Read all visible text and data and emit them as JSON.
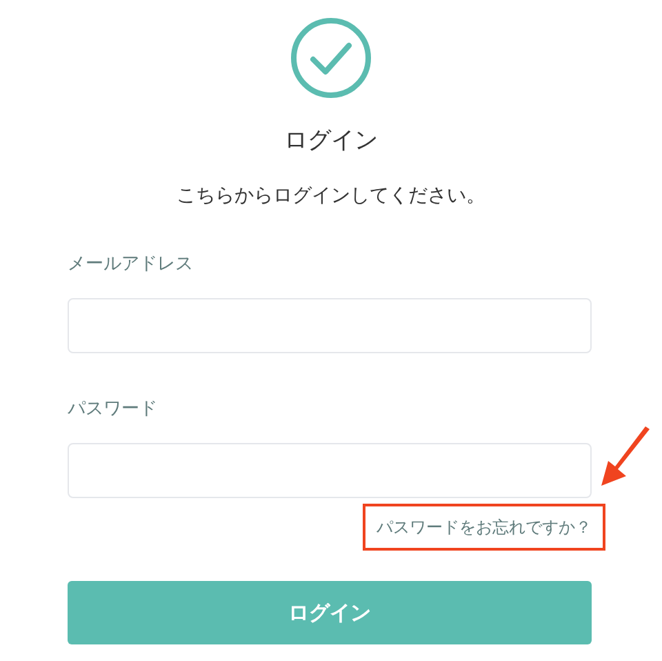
{
  "title": "ログイン",
  "subtitle": "こちらからログインしてください。",
  "fields": [
    {
      "label": "メールアドレス"
    },
    {
      "label": "パスワード"
    }
  ],
  "forgot_link": {
    "label": "パスワードをお忘れですか？",
    "highlighted": true
  },
  "button": {
    "label": "ログイン"
  }
}
